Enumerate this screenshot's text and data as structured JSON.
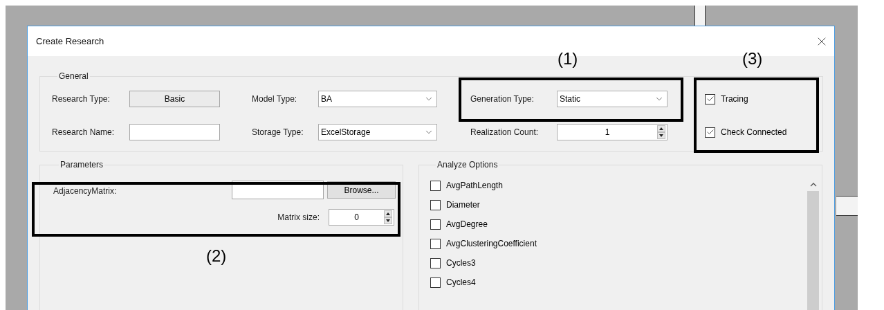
{
  "window": {
    "title": "Create Research"
  },
  "general": {
    "label": "General",
    "research_type": {
      "label": "Research Type:",
      "value": "Basic"
    },
    "research_name": {
      "label": "Research Name:"
    },
    "model_type": {
      "label": "Model Type:",
      "value": "BA"
    },
    "storage_type": {
      "label": "Storage Type:",
      "value": "ExcelStorage"
    },
    "generation_type": {
      "label": "Generation Type:",
      "value": "Static"
    },
    "realization_count": {
      "label": "Realization Count:",
      "value": "1"
    },
    "options": [
      {
        "label": "Tracing",
        "checked": true
      },
      {
        "label": "Check Connected",
        "checked": true
      }
    ]
  },
  "parameters": {
    "label": "Parameters",
    "adjacency_matrix": {
      "label": "AdjacencyMatrix:",
      "button": "Browse..."
    },
    "matrix_size": {
      "label": "Matrix size:",
      "value": "0"
    }
  },
  "analyze_options": {
    "label": "Analyze Options",
    "items": [
      {
        "label": "AvgPathLength",
        "checked": false
      },
      {
        "label": "Diameter",
        "checked": false
      },
      {
        "label": "AvgDegree",
        "checked": false
      },
      {
        "label": "AvgClusteringCoefficient",
        "checked": false
      },
      {
        "label": "Cycles3",
        "checked": false
      },
      {
        "label": "Cycles4",
        "checked": false
      }
    ]
  },
  "annotations": [
    "(1)",
    "(2)",
    "(3)"
  ]
}
